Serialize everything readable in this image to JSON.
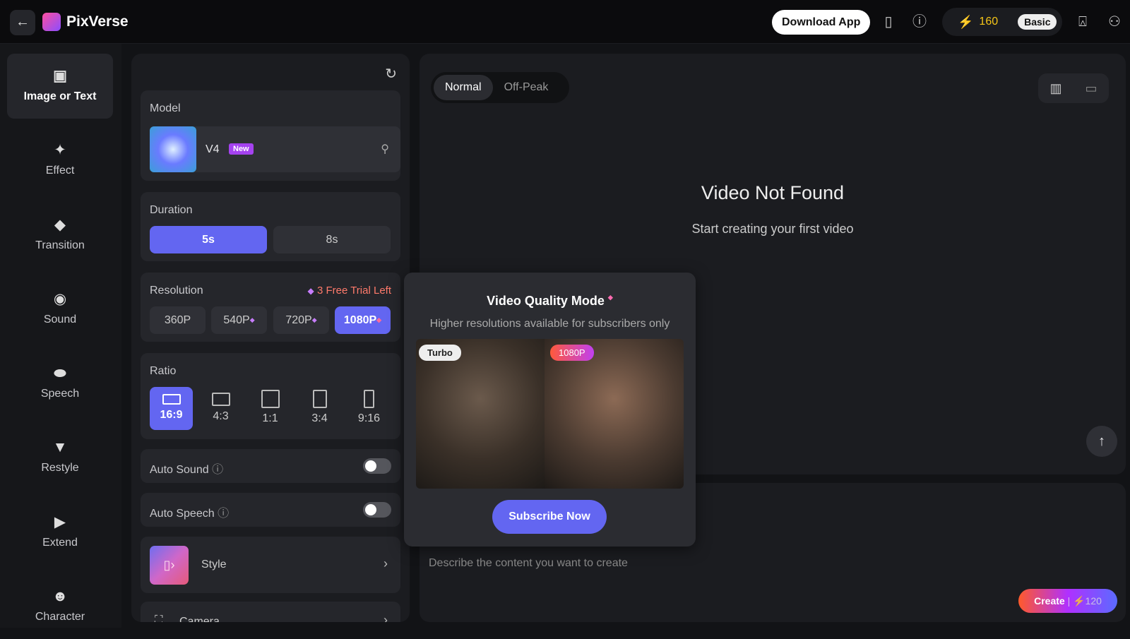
{
  "header": {
    "app_name": "PixVerse",
    "download": "Download App",
    "credits": "160",
    "plan": "Basic"
  },
  "sidebar": {
    "items": [
      {
        "label": "Image or Text"
      },
      {
        "label": "Effect"
      },
      {
        "label": "Transition"
      },
      {
        "label": "Sound"
      },
      {
        "label": "Speech"
      },
      {
        "label": "Restyle"
      },
      {
        "label": "Extend"
      },
      {
        "label": "Character"
      }
    ]
  },
  "settings": {
    "model_label": "Model",
    "model_name": "V4",
    "model_badge": "New",
    "duration_label": "Duration",
    "durations": [
      "5s",
      "8s"
    ],
    "resolution_label": "Resolution",
    "trial": "3 Free Trial Left",
    "resolutions": [
      "360P",
      "540P",
      "720P",
      "1080P"
    ],
    "ratio_label": "Ratio",
    "ratios": [
      "16:9",
      "4:3",
      "1:1",
      "3:4",
      "9:16"
    ],
    "auto_sound": "Auto Sound",
    "auto_speech": "Auto Speech",
    "style": "Style",
    "camera": "Camera"
  },
  "main": {
    "modes": [
      "Normal",
      "Off-Peak"
    ],
    "empty_title": "Video Not Found",
    "empty_sub": "Start creating your first video",
    "prompt_placeholder": "Describe the content you want to create",
    "create": "Create",
    "create_cost": "120"
  },
  "popup": {
    "title": "Video Quality Mode",
    "subtitle": "Higher resolutions available for subscribers only",
    "tag_left": "Turbo",
    "tag_right": "1080P",
    "cta": "Subscribe Now"
  }
}
